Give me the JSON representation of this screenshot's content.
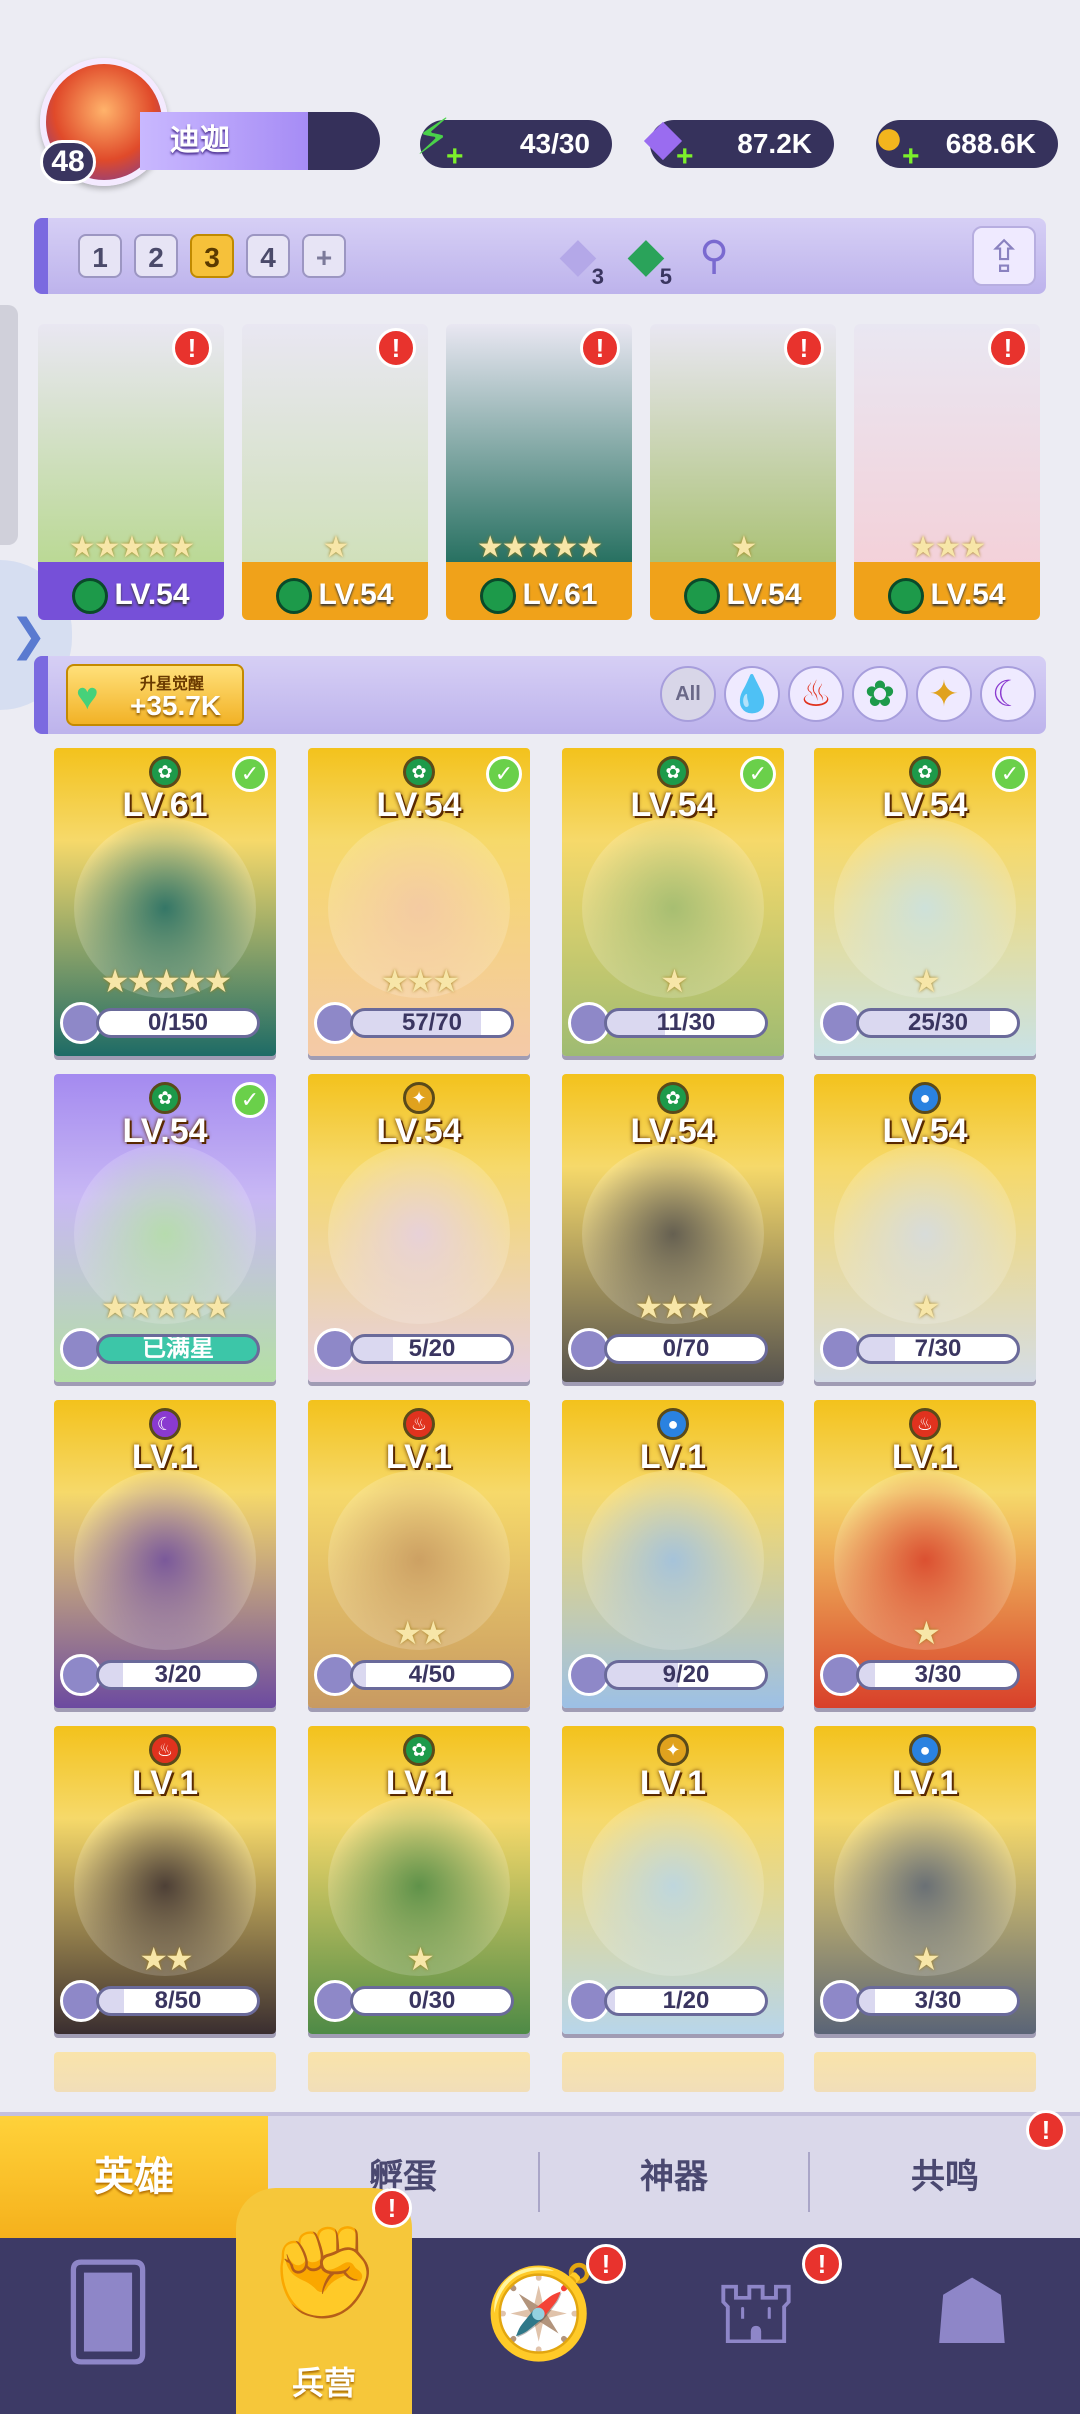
{
  "player": {
    "level": "48",
    "name": "迪迦"
  },
  "resources": {
    "energy": "43/30",
    "gems": "87.2K",
    "gold": "688.6K"
  },
  "teams": {
    "tabs": [
      "1",
      "2",
      "3",
      "4",
      "+"
    ],
    "active_index": 2,
    "card_a_count": "3",
    "card_b_count": "5"
  },
  "team_slots": [
    {
      "stars": "★★★★★",
      "level": "LV.54",
      "alert": "!",
      "base": "purple"
    },
    {
      "stars": "★",
      "level": "LV.54",
      "alert": "!",
      "base": "gold"
    },
    {
      "stars": "★★★★★",
      "level": "LV.61",
      "alert": "!",
      "base": "gold"
    },
    {
      "stars": "★",
      "level": "LV.54",
      "alert": "!",
      "base": "gold"
    },
    {
      "stars": "★★★",
      "level": "LV.54",
      "alert": "!",
      "base": "gold"
    }
  ],
  "awaken": {
    "label": "升星觉醒",
    "value": "+35.7K"
  },
  "filters": {
    "all_label": "All",
    "elements": [
      "water",
      "fire",
      "wind",
      "light",
      "dark"
    ]
  },
  "heroes": [
    {
      "level": "LV.61",
      "element": "wind",
      "checked": true,
      "stars": "★★★★★",
      "progress": "0/150",
      "fill": 0.0,
      "color": "#1e6b66"
    },
    {
      "level": "LV.54",
      "element": "wind",
      "checked": true,
      "stars": "★★★",
      "progress": "57/70",
      "fill": 0.81,
      "color": "#f4c9a8"
    },
    {
      "level": "LV.54",
      "element": "wind",
      "checked": true,
      "stars": "★",
      "progress": "11/30",
      "fill": 0.37,
      "color": "#9ebb72"
    },
    {
      "level": "LV.54",
      "element": "wind",
      "checked": true,
      "stars": "★",
      "progress": "25/30",
      "fill": 0.83,
      "color": "#c9e2e6"
    },
    {
      "level": "LV.54",
      "element": "wind",
      "checked": true,
      "stars": "★★★★★",
      "progress": "已满星",
      "fill": 1.0,
      "full": true,
      "color": "#b4e0a4",
      "purple": true
    },
    {
      "level": "LV.54",
      "element": "light",
      "checked": false,
      "stars": "",
      "progress": "5/20",
      "fill": 0.25,
      "color": "#e6d0e4"
    },
    {
      "level": "LV.54",
      "element": "wind",
      "checked": false,
      "stars": "★★★",
      "progress": "0/70",
      "fill": 0.0,
      "color": "#55524e"
    },
    {
      "level": "LV.54",
      "element": "water",
      "checked": false,
      "stars": "★",
      "progress": "7/30",
      "fill": 0.23,
      "color": "#d4dce6"
    },
    {
      "level": "LV.1",
      "element": "dark",
      "checked": false,
      "stars": "",
      "progress": "3/20",
      "fill": 0.15,
      "color": "#6c4aa0"
    },
    {
      "level": "LV.1",
      "element": "fire",
      "checked": false,
      "stars": "★★",
      "progress": "4/50",
      "fill": 0.08,
      "color": "#c89a62"
    },
    {
      "level": "LV.1",
      "element": "water",
      "checked": false,
      "stars": "",
      "progress": "9/20",
      "fill": 0.45,
      "color": "#9cc0e6"
    },
    {
      "level": "LV.1",
      "element": "fire",
      "checked": false,
      "stars": "★",
      "progress": "3/30",
      "fill": 0.1,
      "color": "#d8402a"
    },
    {
      "level": "LV.1",
      "element": "fire",
      "checked": false,
      "stars": "★★",
      "progress": "8/50",
      "fill": 0.16,
      "color": "#3a2e30"
    },
    {
      "level": "LV.1",
      "element": "wind",
      "checked": false,
      "stars": "★",
      "progress": "0/30",
      "fill": 0.0,
      "color": "#4e8a46"
    },
    {
      "level": "LV.1",
      "element": "light",
      "checked": false,
      "stars": "",
      "progress": "1/20",
      "fill": 0.05,
      "color": "#b8d6ea"
    },
    {
      "level": "LV.1",
      "element": "water",
      "checked": false,
      "stars": "★",
      "progress": "3/30",
      "fill": 0.1,
      "color": "#5a6476"
    }
  ],
  "subtabs": [
    "英雄",
    "孵蛋",
    "神器",
    "共鸣"
  ],
  "bottom_nav": [
    {
      "icon": "cards-icon",
      "label": ""
    },
    {
      "icon": "barracks-icon",
      "label": "兵营",
      "alert": "!"
    },
    {
      "icon": "map-icon",
      "label": "",
      "alert": "!"
    },
    {
      "icon": "castle-icon",
      "label": "",
      "alert": "!"
    },
    {
      "icon": "mushroom-icon",
      "label": ""
    }
  ],
  "colors": {
    "gold": "#f5b11c",
    "purple": "#7b6ae0",
    "navy": "#3d3a66",
    "alert": "#e8332d"
  }
}
